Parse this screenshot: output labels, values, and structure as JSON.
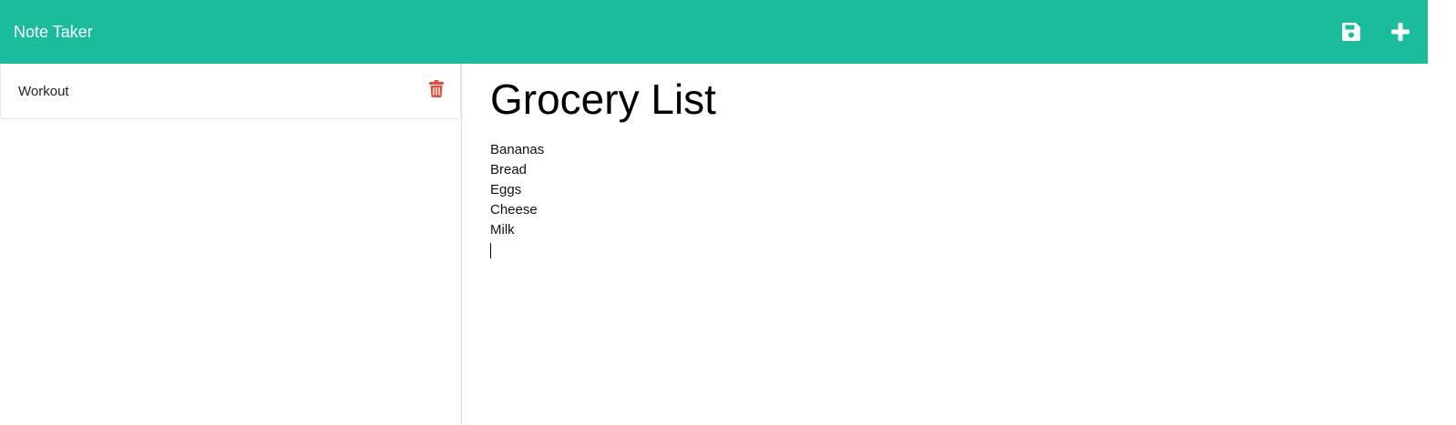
{
  "app": {
    "brand": "Note Taker",
    "accent_color": "#1abc9c",
    "delete_color": "#e74c3c"
  },
  "toolbar": {
    "save_icon": "save-icon",
    "add_icon": "plus-icon"
  },
  "sidebar": {
    "items": [
      {
        "title": "Workout",
        "icon": "trash-icon"
      }
    ]
  },
  "note": {
    "title": "Grocery List",
    "lines": [
      "Bananas",
      "Bread",
      "Eggs",
      "Cheese",
      "Milk"
    ]
  }
}
